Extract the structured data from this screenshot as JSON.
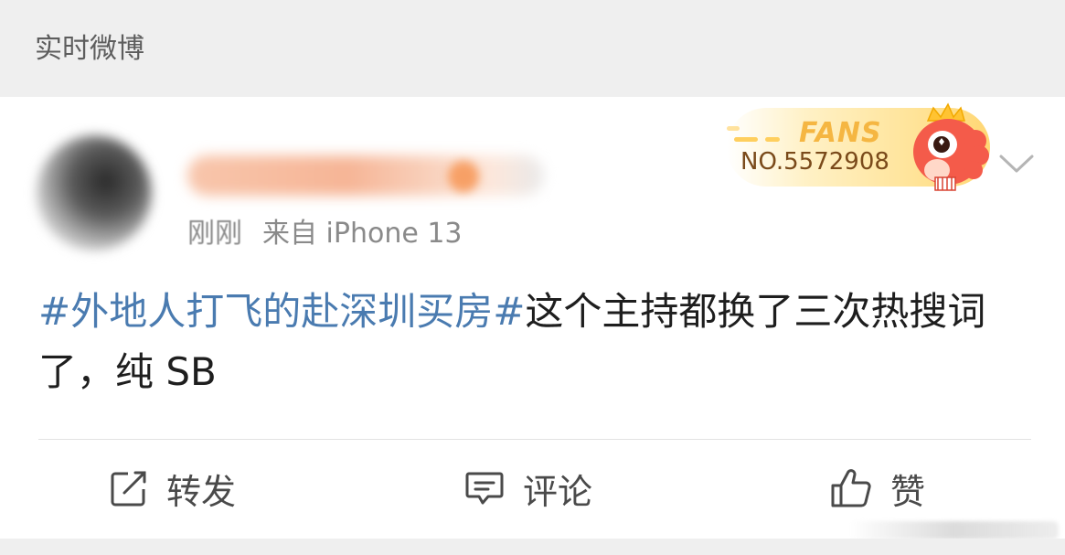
{
  "header": {
    "title": "实时微博"
  },
  "post": {
    "meta": {
      "time": "刚刚",
      "source": "来自 iPhone 13"
    },
    "fans_badge": {
      "word": "FANS",
      "number": "NO.5572908"
    },
    "content": {
      "topic": "#外地人打飞的赴深圳买房#",
      "text": "这个主持都换了三次热搜词了，纯 SB"
    },
    "actions": {
      "repost": "转发",
      "comment": "评论",
      "like": "赞"
    }
  },
  "colors": {
    "topic_link": "#4a7bb0",
    "header_bg": "#efefef",
    "fans_gold": "#f5b642"
  },
  "icons": [
    "avatar",
    "fans-badge-mascot",
    "chevron-down-icon",
    "repost-icon",
    "comment-icon",
    "like-icon"
  ]
}
